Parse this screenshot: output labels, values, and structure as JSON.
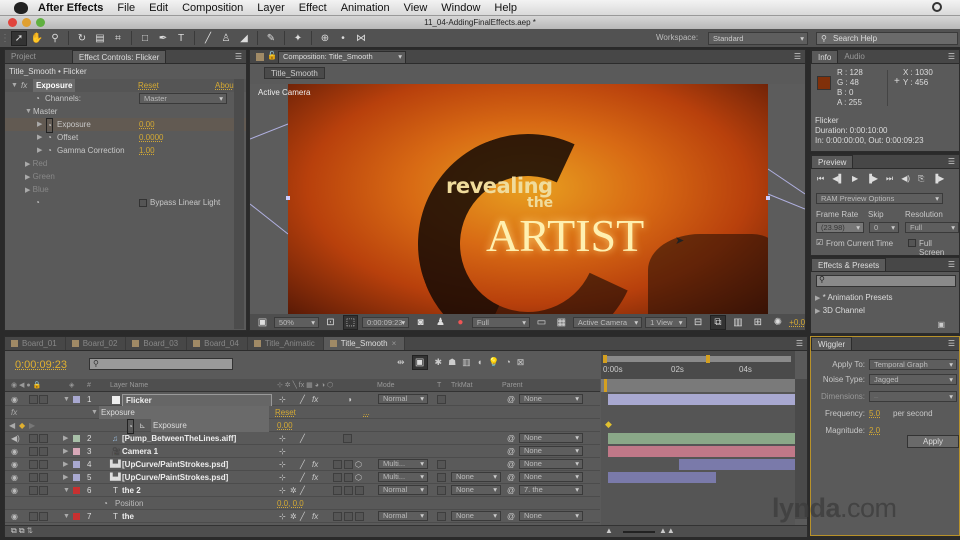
{
  "menubar": {
    "app": "After Effects",
    "items": [
      "File",
      "Edit",
      "Composition",
      "Layer",
      "Effect",
      "Animation",
      "View",
      "Window",
      "Help"
    ]
  },
  "window": {
    "title": "11_04-AddingFinalEffects.aep *"
  },
  "toolbar": {
    "workspace_label": "Workspace:",
    "workspace_value": "Standard",
    "search_placeholder": "Search Help"
  },
  "effect_panel": {
    "tabs": [
      "Project",
      "Effect Controls: Flicker"
    ],
    "breadcrumb": "Title_Smooth • Flicker",
    "effect_name": "Exposure",
    "reset": "Reset",
    "about": "Abou",
    "channels_label": "Channels:",
    "channels_value": "Master",
    "master_label": "Master",
    "props": [
      {
        "label": "Exposure",
        "value": "0.00"
      },
      {
        "label": "Offset",
        "value": "0.0000"
      },
      {
        "label": "Gamma Correction",
        "value": "1.00"
      }
    ],
    "groups": [
      "Red",
      "Green",
      "Blue"
    ],
    "bypass_label": "Bypass Linear Light",
    "bypass_checked": false
  },
  "comp_panel": {
    "tab": "Composition: Title_Smooth",
    "nav_button": "Title_Smooth",
    "view_label": "Active Camera",
    "artwork": {
      "line1": "revealing",
      "line2": "the",
      "line3": "ARTIST"
    },
    "footer": {
      "zoom": "50%",
      "timecode": "0:00:09:23",
      "resolution": "Full",
      "camera": "Active Camera",
      "views": "1 View",
      "exposure": "+0.0"
    }
  },
  "info_panel": {
    "tabs": [
      "Info",
      "Audio"
    ],
    "color_swatch": "#80300a",
    "r": "R : 128",
    "g": "G : 48",
    "b": "B : 0",
    "a": "A : 255",
    "x": "X : 1030",
    "y": "Y : 456",
    "layer": "Flicker",
    "duration": "Duration: 0:00:10:00",
    "inout": "In: 0:00:00:00, Out: 0:00:09:23"
  },
  "preview_panel": {
    "tab": "Preview",
    "ram_options": "RAM Preview Options",
    "frame_rate_label": "Frame Rate",
    "skip_label": "Skip",
    "resolution_label": "Resolution",
    "frame_rate": "(23.98)",
    "skip": "0",
    "resolution": "Full",
    "from_current": "From Current Time",
    "from_current_checked": true,
    "full_screen": "Full Screen",
    "full_screen_checked": false
  },
  "effects_presets": {
    "tab": "Effects & Presets",
    "search_placeholder": "",
    "items": [
      "* Animation Presets",
      "3D Channel"
    ]
  },
  "wiggler": {
    "tab": "Wiggler",
    "apply_to_label": "Apply To:",
    "apply_to": "Temporal Graph",
    "noise_label": "Noise Type:",
    "noise": "Jagged",
    "dimensions_label": "Dimensions:",
    "dimensions": "–",
    "frequency_label": "Frequency:",
    "frequency": "5.0",
    "frequency_unit": "per second",
    "magnitude_label": "Magnitude:",
    "magnitude": "2.0",
    "apply_button": "Apply"
  },
  "timeline": {
    "tabs": [
      "Board_01",
      "Board_02",
      "Board_03",
      "Board_04",
      "Title_Animatic",
      "Title_Smooth"
    ],
    "active_tab": "Title_Smooth",
    "timecode": "0:00:09:23",
    "columns": {
      "layer_name": "Layer Name",
      "mode": "Mode",
      "t": "T",
      "trkmat": "TrkMat",
      "parent": "Parent"
    },
    "ruler": [
      "0:00s",
      "02s",
      "04s"
    ],
    "layers": [
      {
        "num": "1",
        "name": "Flicker",
        "color": "#a8a8d0",
        "mode": "Normal",
        "trkmat": "",
        "parent": "None"
      },
      {
        "num": "2",
        "name": "[Pump_BetweenTheLines.aiff]",
        "color": "#a8c0a8",
        "mode": "",
        "trkmat": "",
        "parent": "None"
      },
      {
        "num": "3",
        "name": "Camera 1",
        "color": "#d8a8b8",
        "mode": "",
        "trkmat": "",
        "parent": "None"
      },
      {
        "num": "4",
        "name": "[UpCurve/PaintStrokes.psd]",
        "color": "#a8a8d0",
        "mode": "Multi...",
        "trkmat": "",
        "parent": "None"
      },
      {
        "num": "5",
        "name": "[UpCurve/PaintStrokes.psd]",
        "color": "#a8a8d0",
        "mode": "Multi...",
        "trkmat": "None",
        "parent": "None"
      },
      {
        "num": "6",
        "name": "the 2",
        "color": "#c83030",
        "mode": "Normal",
        "trkmat": "None",
        "parent": "7. the"
      },
      {
        "num": "7",
        "name": "the",
        "color": "#c83030",
        "mode": "Normal",
        "trkmat": "None",
        "parent": "None"
      }
    ],
    "effect_row": {
      "name": "Exposure",
      "reset": "Reset",
      "dots": "..."
    },
    "prop_row": {
      "name": "Exposure",
      "value": "0.00"
    },
    "position_row": {
      "name": "Position",
      "value": "0.0, 0.0"
    }
  },
  "watermark": {
    "brand": "lynda",
    "tld": ".com"
  }
}
